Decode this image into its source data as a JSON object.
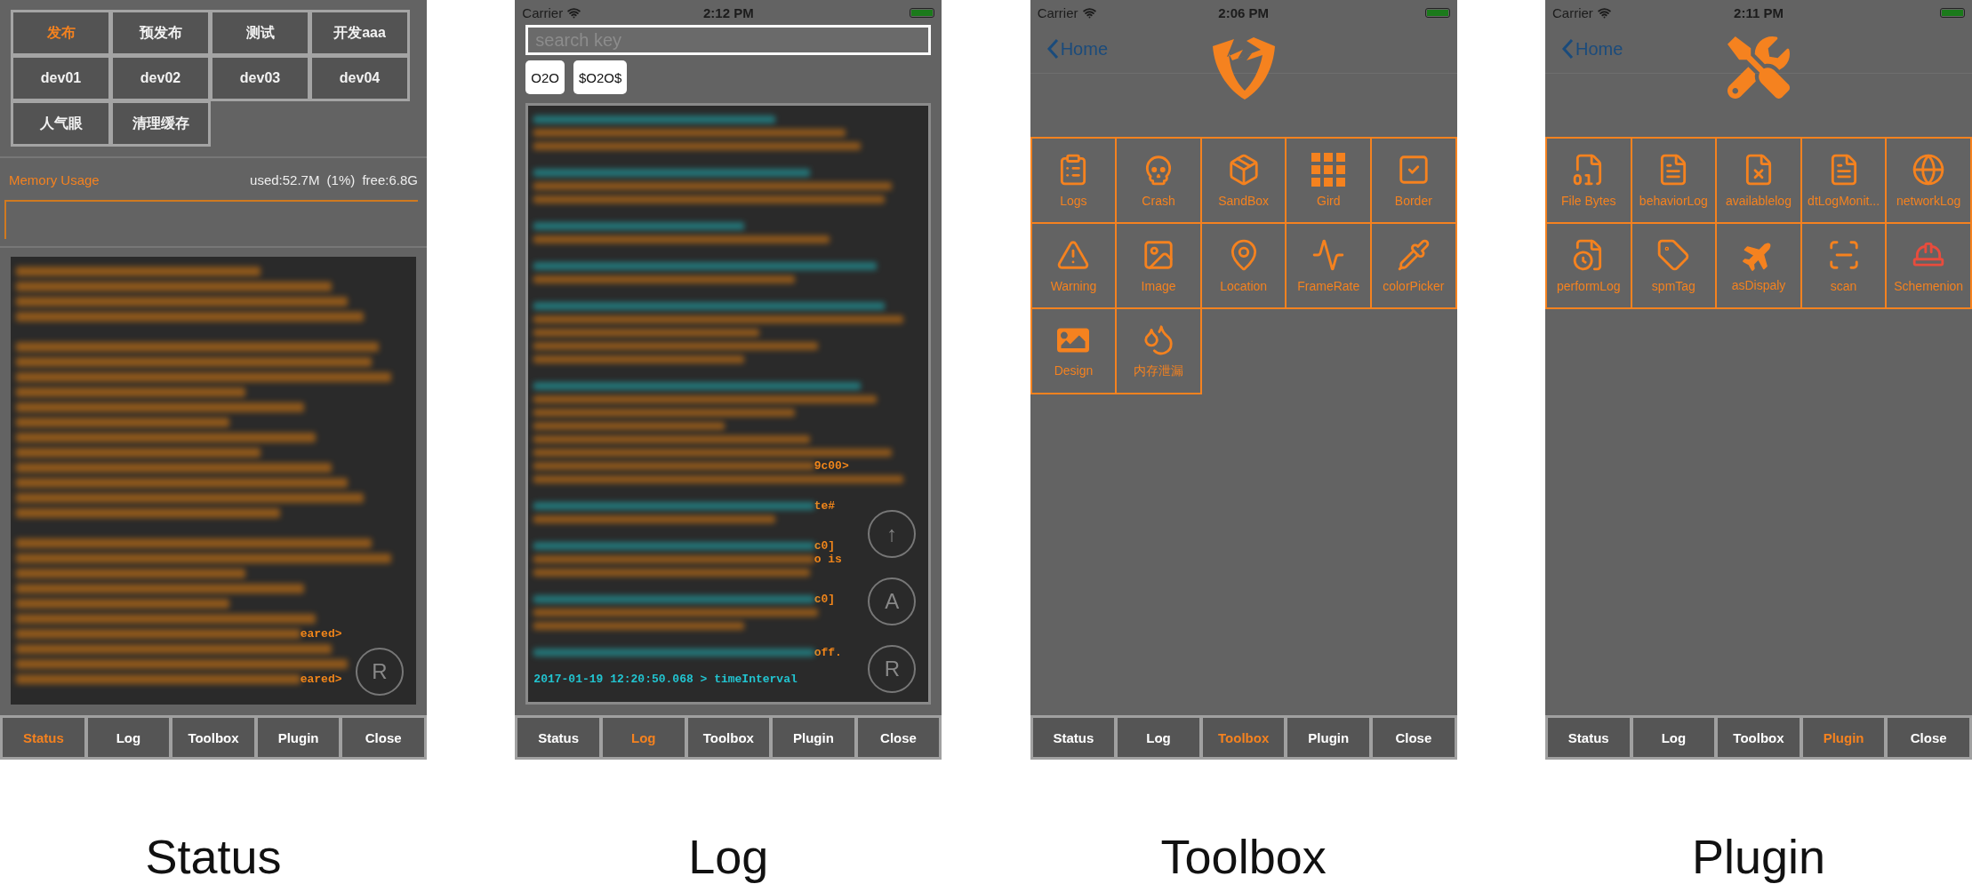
{
  "panels": [
    {
      "kind": "status",
      "caption": "Status",
      "env_buttons": [
        {
          "label": "发布",
          "selected": true
        },
        {
          "label": "预发布",
          "selected": false
        },
        {
          "label": "测试",
          "selected": false
        },
        {
          "label": "开发aaa",
          "selected": false
        },
        {
          "label": "dev01",
          "selected": false
        },
        {
          "label": "dev02",
          "selected": false
        },
        {
          "label": "dev03",
          "selected": false
        },
        {
          "label": "dev04",
          "selected": false
        },
        {
          "label": "人气眼",
          "selected": false
        },
        {
          "label": "清理缓存",
          "selected": false
        }
      ],
      "memory": {
        "title": "Memory Usage",
        "used": "used:52.7M (1%)",
        "free": "free:6.8G"
      },
      "log_entries": [
        [
          {
            "kind": "text"
          },
          {
            "kind": "text"
          },
          {
            "kind": "text"
          },
          {
            "kind": "text"
          }
        ],
        [
          {
            "kind": "text"
          },
          {
            "kind": "text"
          },
          {
            "kind": "text"
          },
          {
            "kind": "text"
          },
          {
            "kind": "text"
          },
          {
            "kind": "text"
          },
          {
            "kind": "text"
          },
          {
            "kind": "text"
          },
          {
            "kind": "text"
          },
          {
            "kind": "text"
          },
          {
            "kind": "text"
          },
          {
            "kind": "text"
          }
        ],
        [
          {
            "kind": "text"
          },
          {
            "kind": "text"
          },
          {
            "kind": "text"
          },
          {
            "kind": "text"
          },
          {
            "kind": "text"
          },
          {
            "kind": "text"
          },
          {
            "kind": "text",
            "tail": "eared>"
          },
          {
            "kind": "text"
          },
          {
            "kind": "text"
          },
          {
            "kind": "text",
            "tail": "eared>"
          }
        ]
      ],
      "float_buttons": [
        "R"
      ],
      "tabs": [
        {
          "label": "Status",
          "selected": true
        },
        {
          "label": "Log",
          "selected": false
        },
        {
          "label": "Toolbox",
          "selected": false
        },
        {
          "label": "Plugin",
          "selected": false
        },
        {
          "label": "Close",
          "selected": false
        }
      ]
    },
    {
      "kind": "log",
      "caption": "Log",
      "status_bar": {
        "carrier": "Carrier",
        "time": "2:12 PM"
      },
      "search": {
        "placeholder": "search key"
      },
      "chips": [
        "O2O",
        "$O2O$"
      ],
      "log_entries": [
        [
          {
            "kind": "stamp"
          },
          {
            "kind": "text"
          },
          {
            "kind": "text"
          }
        ],
        [
          {
            "kind": "stamp"
          },
          {
            "kind": "text"
          },
          {
            "kind": "text"
          }
        ],
        [
          {
            "kind": "stamp"
          },
          {
            "kind": "text"
          }
        ],
        [
          {
            "kind": "stamp"
          },
          {
            "kind": "text"
          }
        ],
        [
          {
            "kind": "stamp"
          },
          {
            "kind": "text"
          },
          {
            "kind": "text"
          },
          {
            "kind": "text"
          },
          {
            "kind": "text"
          }
        ],
        [
          {
            "kind": "stamp"
          },
          {
            "kind": "text"
          },
          {
            "kind": "text"
          },
          {
            "kind": "text"
          },
          {
            "kind": "text"
          },
          {
            "kind": "text"
          },
          {
            "kind": "text",
            "tail": "9c00>"
          },
          {
            "kind": "text"
          }
        ],
        [
          {
            "kind": "stamp",
            "tail": "te#"
          },
          {
            "kind": "text"
          }
        ],
        [
          {
            "kind": "stamp",
            "tail": "c0]"
          },
          {
            "kind": "text",
            "tail": "o is"
          },
          {
            "kind": "text"
          }
        ],
        [
          {
            "kind": "stamp",
            "tail": "c0]"
          },
          {
            "kind": "text"
          },
          {
            "kind": "text"
          }
        ],
        [
          {
            "kind": "stamp",
            "tail": "off."
          }
        ],
        [
          {
            "kind": "clear",
            "text": "2017-01-19 12:20:50.068 > timeInterval"
          }
        ]
      ],
      "float_buttons": [
        "↑",
        "A",
        "R"
      ],
      "tabs": [
        {
          "label": "Status",
          "selected": false
        },
        {
          "label": "Log",
          "selected": true
        },
        {
          "label": "Toolbox",
          "selected": false
        },
        {
          "label": "Plugin",
          "selected": false
        },
        {
          "label": "Close",
          "selected": false
        }
      ]
    },
    {
      "kind": "toolbox",
      "caption": "Toolbox",
      "status_bar": {
        "carrier": "Carrier",
        "time": "2:06 PM"
      },
      "nav": {
        "back": "Home"
      },
      "items": [
        {
          "label": "Logs"
        },
        {
          "label": "Crash"
        },
        {
          "label": "SandBox"
        },
        {
          "label": "Gird"
        },
        {
          "label": "Border"
        },
        {
          "label": "Warning"
        },
        {
          "label": "Image"
        },
        {
          "label": "Location"
        },
        {
          "label": "FrameRate"
        },
        {
          "label": "colorPicker"
        },
        {
          "label": "Design"
        },
        {
          "label": "内存泄漏"
        }
      ],
      "tabs": [
        {
          "label": "Status",
          "selected": false
        },
        {
          "label": "Log",
          "selected": false
        },
        {
          "label": "Toolbox",
          "selected": true
        },
        {
          "label": "Plugin",
          "selected": false
        },
        {
          "label": "Close",
          "selected": false
        }
      ]
    },
    {
      "kind": "plugin",
      "caption": "Plugin",
      "status_bar": {
        "carrier": "Carrier",
        "time": "2:11 PM"
      },
      "nav": {
        "back": "Home"
      },
      "items": [
        {
          "label": "File Bytes"
        },
        {
          "label": "behaviorLog"
        },
        {
          "label": "availablelog"
        },
        {
          "label": "dtLogMonit..."
        },
        {
          "label": "networkLog"
        },
        {
          "label": "performLog"
        },
        {
          "label": "spmTag"
        },
        {
          "label": "asDispaly"
        },
        {
          "label": "scan"
        },
        {
          "label": "Schemenion"
        }
      ],
      "tabs": [
        {
          "label": "Status",
          "selected": false
        },
        {
          "label": "Log",
          "selected": false
        },
        {
          "label": "Toolbox",
          "selected": false
        },
        {
          "label": "Plugin",
          "selected": true
        },
        {
          "label": "Close",
          "selected": false
        }
      ]
    }
  ]
}
